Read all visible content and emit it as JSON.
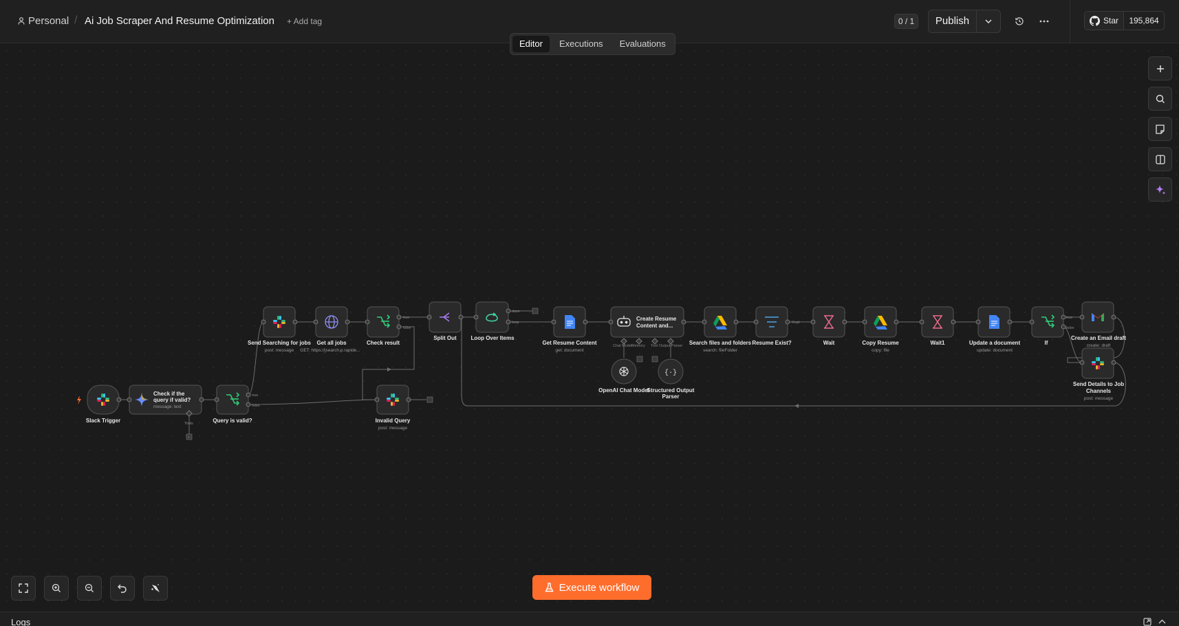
{
  "header": {
    "project": "Personal",
    "workflow_name": "Ai Job Scraper And Resume Optimization",
    "add_tag": "+ Add tag",
    "counter": "0 / 1",
    "publish": "Publish",
    "github_star": "Star",
    "github_count": "195,864"
  },
  "tabs": [
    {
      "label": "Editor",
      "active": true
    },
    {
      "label": "Executions",
      "active": false
    },
    {
      "label": "Evaluations",
      "active": false
    }
  ],
  "nodes": {
    "slack_trigger": {
      "label": "Slack Trigger"
    },
    "check_query": {
      "label_line1": "Check if the",
      "label_line2": "query if valid?",
      "sub": "message: text",
      "tools": "Tools"
    },
    "query_valid": {
      "label": "Query is valid?",
      "out_true": "true",
      "out_false": "false"
    },
    "send_searching": {
      "label": "Send Searching for jobs",
      "sub": "post: message"
    },
    "get_all_jobs": {
      "label": "Get all jobs",
      "sub": "GET: https://jsearch.p.rapide..."
    },
    "check_result": {
      "label": "Check result",
      "out_true": "true",
      "out_false": "false"
    },
    "invalid_query": {
      "label": "Invalid Query",
      "sub": "post: message"
    },
    "split_out": {
      "label": "Split Out"
    },
    "loop_over": {
      "label": "Loop Over Items",
      "out_done": "done",
      "out_loop": "loop"
    },
    "get_resume": {
      "label": "Get Resume Content",
      "sub": "get: document"
    },
    "create_resume": {
      "label_line1": "Create Resume",
      "label_line2": "Content and...",
      "port1": "Chat Model",
      "port2": "Memory",
      "port3": "Tool",
      "port4": "Output Parser"
    },
    "openai_model": {
      "label": "OpenAI Chat Model"
    },
    "structured_parser": {
      "label_line1": "Structured Output",
      "label_line2": "Parser"
    },
    "search_files": {
      "label": "Search files and folders",
      "sub": "search: fileFolder"
    },
    "resume_exist": {
      "label": "Resume Exist?",
      "out_kept": "Kept"
    },
    "wait": {
      "label": "Wait"
    },
    "copy_resume": {
      "label": "Copy Resume",
      "sub": "copy: file"
    },
    "wait1": {
      "label": "Wait1"
    },
    "update_doc": {
      "label": "Update a document",
      "sub": "update: document"
    },
    "if_node": {
      "label": "If",
      "out_true": "true",
      "out_false": "false"
    },
    "email_draft": {
      "label": "Create an Email draft",
      "sub": "create: draft"
    },
    "send_details": {
      "label_line1": "Send Details to Job",
      "label_line2": "Channels",
      "sub": "post: message"
    }
  },
  "execute": "Execute workflow",
  "logs": "Logs",
  "icons": {
    "person": "person-icon",
    "history": "history-icon",
    "more": "more-icon",
    "github": "github-icon",
    "plus": "plus-icon",
    "search": "search-icon",
    "note": "sticky-note-icon",
    "panel": "panel-icon",
    "ai": "sparkle-icon",
    "fit": "fit-view-icon",
    "zoom_in": "zoom-in-icon",
    "zoom_out": "zoom-out-icon",
    "undo": "undo-icon",
    "clean": "tidy-icon",
    "flask": "flask-icon"
  },
  "colors": {
    "accent": "#ff6d2d"
  }
}
